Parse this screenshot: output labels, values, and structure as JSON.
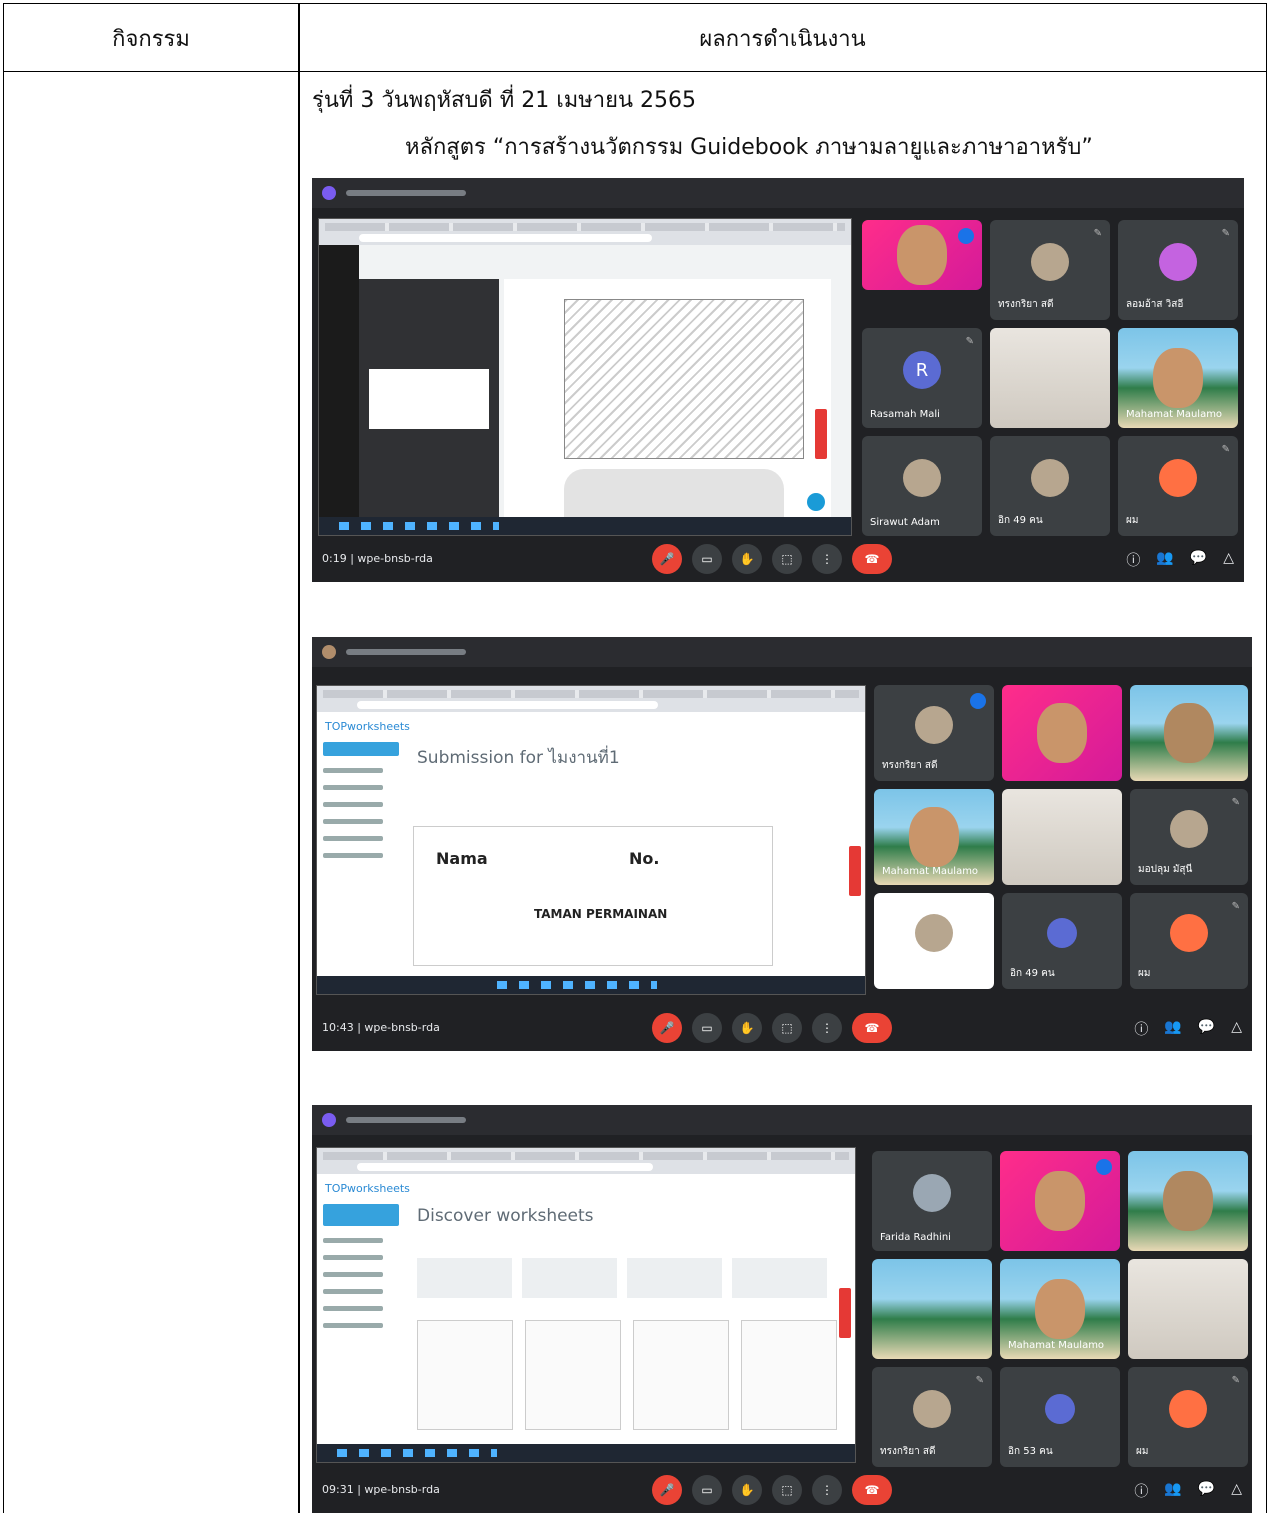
{
  "table": {
    "header_left": "กิจกรรม",
    "header_right": "ผลการดำเนินงาน"
  },
  "content": {
    "line1": "รุ่นที่ 3  วันพฤหัสบดี ที่ 21  เมษายน  2565",
    "line2": "หลักสูตร “การสร้างนวัตกรรม Guidebook ภาษามลายูและภาษาอาหรับ”"
  },
  "screens": [
    {
      "meeting_code": "0:19  |  wpe-bnsb-rda",
      "participants": [
        {
          "name": ""
        },
        {
          "name": "ทรงกริยา สดี"
        },
        {
          "name": "ลอมอ้าส วิสอี"
        },
        {
          "name": "Rasamah Mali",
          "initial": "R"
        },
        {
          "name": ""
        },
        {
          "name": "Mahamat Maulamo"
        },
        {
          "name": "Sirawut Adam"
        },
        {
          "name": "อิก 49 คน"
        },
        {
          "name": "ผม"
        }
      ]
    },
    {
      "meeting_code": "10:43  |  wpe-bnsb-rda",
      "worksheet_logo": "TOPworksheets",
      "worksheet_heading": "Submission for ไมงานที่1",
      "nama_label": "Nama",
      "no_label": "No.",
      "taman_label": "TAMAN PERMAINAN",
      "participants": [
        {
          "name": "ทรงกริยา สดี"
        },
        {
          "name": ""
        },
        {
          "name": ""
        },
        {
          "name": "Mahamat Maulamo"
        },
        {
          "name": ""
        },
        {
          "name": "มอปลุม มัสุนี"
        },
        {
          "name": ""
        },
        {
          "name": "อิก 49 คน"
        },
        {
          "name": "ผม"
        }
      ]
    },
    {
      "meeting_code": "09:31  |  wpe-bnsb-rda",
      "worksheet_logo": "TOPworksheets",
      "worksheet_heading": "Discover worksheets",
      "participants": [
        {
          "name": "Farida Radhini"
        },
        {
          "name": ""
        },
        {
          "name": ""
        },
        {
          "name": ""
        },
        {
          "name": "Mahamat Maulamo"
        },
        {
          "name": ""
        },
        {
          "name": "ทรงกริยา สดี"
        },
        {
          "name": "อิก 53 คน"
        },
        {
          "name": "ผม"
        }
      ]
    }
  ]
}
